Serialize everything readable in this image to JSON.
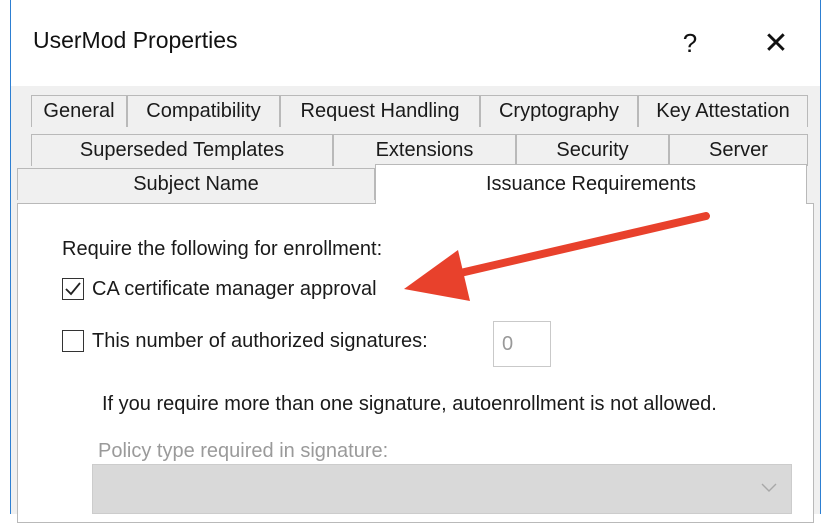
{
  "window": {
    "title": "UserMod Properties",
    "help_label": "?",
    "close_label": "✕"
  },
  "tabs": {
    "row1": [
      "General",
      "Compatibility",
      "Request Handling",
      "Cryptography",
      "Key Attestation"
    ],
    "row2": [
      "Superseded Templates",
      "Extensions",
      "Security",
      "Server"
    ],
    "row3": [
      "Subject Name",
      "Issuance Requirements"
    ],
    "active": "Issuance Requirements"
  },
  "panel": {
    "heading": "Require the following for enrollment:",
    "ca_approval": {
      "label": "CA certificate manager approval",
      "checked": true
    },
    "signatures": {
      "label": "This number of authorized signatures:",
      "checked": false,
      "value": "0"
    },
    "note": "If you require more than one signature, autoenrollment is not allowed.",
    "policy_label": "Policy type required in signature:",
    "policy_value": ""
  },
  "annotation": {
    "color": "#e8412c"
  },
  "colors": {
    "border_accent": "#2d7fd2",
    "tab_border": "#b9b9b9",
    "disabled_text": "#9a9a9a"
  }
}
